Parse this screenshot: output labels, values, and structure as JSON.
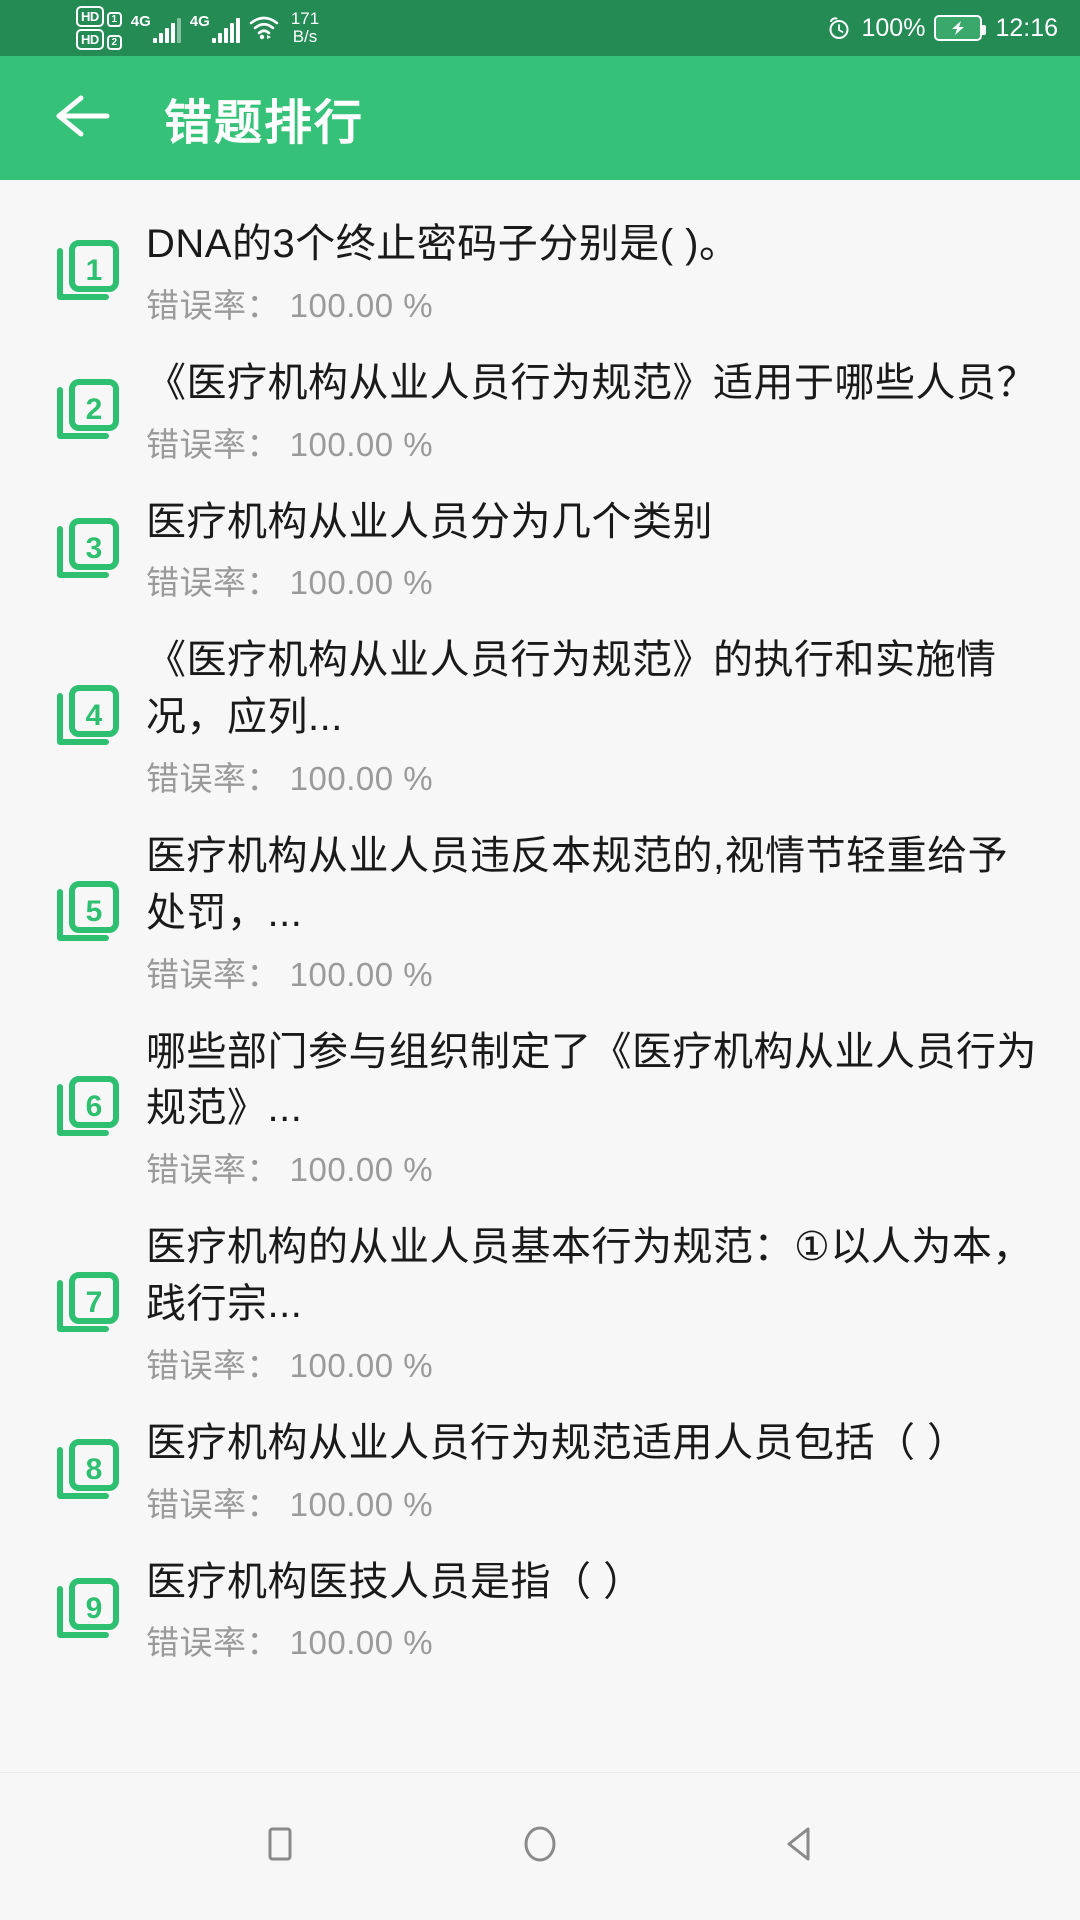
{
  "statusbar": {
    "hd_label_1": "HD",
    "hd_label_2": "HD",
    "sim1_index": "1",
    "sim2_index": "2",
    "net1_label": "4G",
    "net2_label": "4G",
    "wifi_icon": "wifi-icon",
    "speed_value": "171",
    "speed_unit": "B/s",
    "alarm_icon": "alarm-clock-icon",
    "battery_percent": "100%",
    "battery_icon": "battery-charging-icon",
    "clock": "12:16",
    "bg_color": "#258B55"
  },
  "appbar": {
    "back_icon": "arrow-left-icon",
    "title": "错题排行",
    "bg_color": "#35C178"
  },
  "list": {
    "rate_prefix": "错误率：",
    "items": [
      {
        "rank": "1",
        "question": "DNA的3个终止密码子分别是(        )。",
        "rate_label": "错误率： 100.00 %",
        "rate_value": "100.00 %"
      },
      {
        "rank": "2",
        "question": "《医疗机构从业人员行为规范》适用于哪些人员？",
        "rate_label": "错误率： 100.00 %",
        "rate_value": "100.00 %"
      },
      {
        "rank": "3",
        "question": "医疗机构从业人员分为几个类别",
        "rate_label": "错误率： 100.00 %",
        "rate_value": "100.00 %"
      },
      {
        "rank": "4",
        "question": "《医疗机构从业人员行为规范》的执行和实施情况，应列...",
        "rate_label": "错误率： 100.00 %",
        "rate_value": "100.00 %"
      },
      {
        "rank": "5",
        "question": "医疗机构从业人员违反本规范的,视情节轻重给予处罚，...",
        "rate_label": "错误率： 100.00 %",
        "rate_value": "100.00 %"
      },
      {
        "rank": "6",
        "question": "哪些部门参与组织制定了《医疗机构从业人员行为规范》...",
        "rate_label": "错误率： 100.00 %",
        "rate_value": "100.00 %"
      },
      {
        "rank": "7",
        "question": "医疗机构的从业人员基本行为规范：①以人为本，践行宗...",
        "rate_label": "错误率： 100.00 %",
        "rate_value": "100.00 %"
      },
      {
        "rank": "8",
        "question": "医疗机构从业人员行为规范适用人员包括（ ）",
        "rate_label": "错误率： 100.00 %",
        "rate_value": "100.00 %"
      },
      {
        "rank": "9",
        "question": "医疗机构医技人员是指（ ）",
        "rate_label": "错误率： 100.00 %",
        "rate_value": "100.00 %"
      }
    ],
    "badge_color": "#2FBF71",
    "question_color": "#1a1a1a",
    "rate_color": "#9a9a9a",
    "background": "#f7f7f7"
  },
  "navbar": {
    "recents_icon": "square-recents-icon",
    "home_icon": "circle-home-icon",
    "back_icon": "triangle-back-icon",
    "icon_color": "#8a8a8a"
  }
}
